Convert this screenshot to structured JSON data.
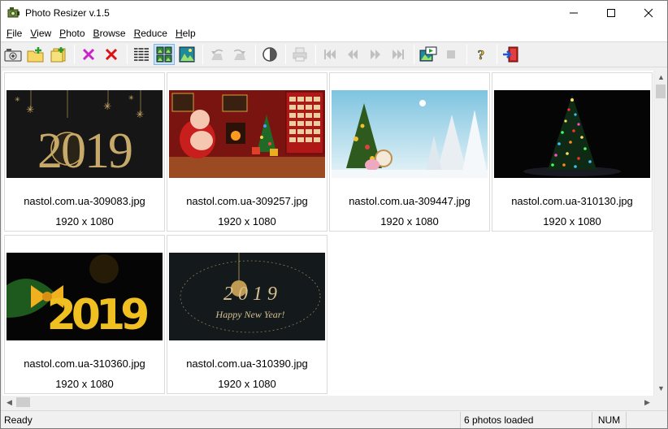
{
  "window": {
    "title": "Photo Resizer v.1.5",
    "controls": {
      "minimize": "—",
      "maximize": "☐",
      "close": "✕"
    }
  },
  "menu": [
    {
      "label": "File",
      "key": "F",
      "rest": "ile"
    },
    {
      "label": "View",
      "key": "V",
      "rest": "iew"
    },
    {
      "label": "Photo",
      "key": "P",
      "rest": "hoto"
    },
    {
      "label": "Browse",
      "key": "B",
      "rest": "rowse"
    },
    {
      "label": "Reduce",
      "key": "R",
      "rest": "educe"
    },
    {
      "label": "Help",
      "key": "H",
      "rest": "elp"
    }
  ],
  "toolbar_icons": [
    "camera-icon",
    "open-folder-icon",
    "add-folder-icon",
    "remove-selected-icon",
    "remove-all-icon",
    "list-view-icon",
    "thumbnail-view-icon",
    "large-thumbnail-view-icon",
    "rotate-left-icon",
    "rotate-right-icon",
    "contrast-icon",
    "print-icon",
    "first-icon",
    "previous-icon",
    "next-icon",
    "last-icon",
    "slideshow-icon",
    "stop-icon",
    "help-icon",
    "exit-icon"
  ],
  "photos": [
    {
      "filename": "nastol.com.ua-309083.jpg",
      "dimensions": "1920 x 1080",
      "image_text": "2019"
    },
    {
      "filename": "nastol.com.ua-309257.jpg",
      "dimensions": "1920 x 1080"
    },
    {
      "filename": "nastol.com.ua-309447.jpg",
      "dimensions": "1920 x 1080"
    },
    {
      "filename": "nastol.com.ua-310130.jpg",
      "dimensions": "1920 x 1080"
    },
    {
      "filename": "nastol.com.ua-310360.jpg",
      "dimensions": "1920 x 1080",
      "image_text": "2019"
    },
    {
      "filename": "nastol.com.ua-310390.jpg",
      "dimensions": "1920 x 1080",
      "image_text": "2 0 1 9",
      "image_subtext": "Happy New Year!"
    }
  ],
  "status": {
    "left": "Ready",
    "count": "6 photos loaded",
    "numlock": "NUM"
  },
  "colors": {
    "selection": "#cce4f7",
    "selection_border": "#7eb4ea",
    "thumb_border": "#dadada"
  }
}
